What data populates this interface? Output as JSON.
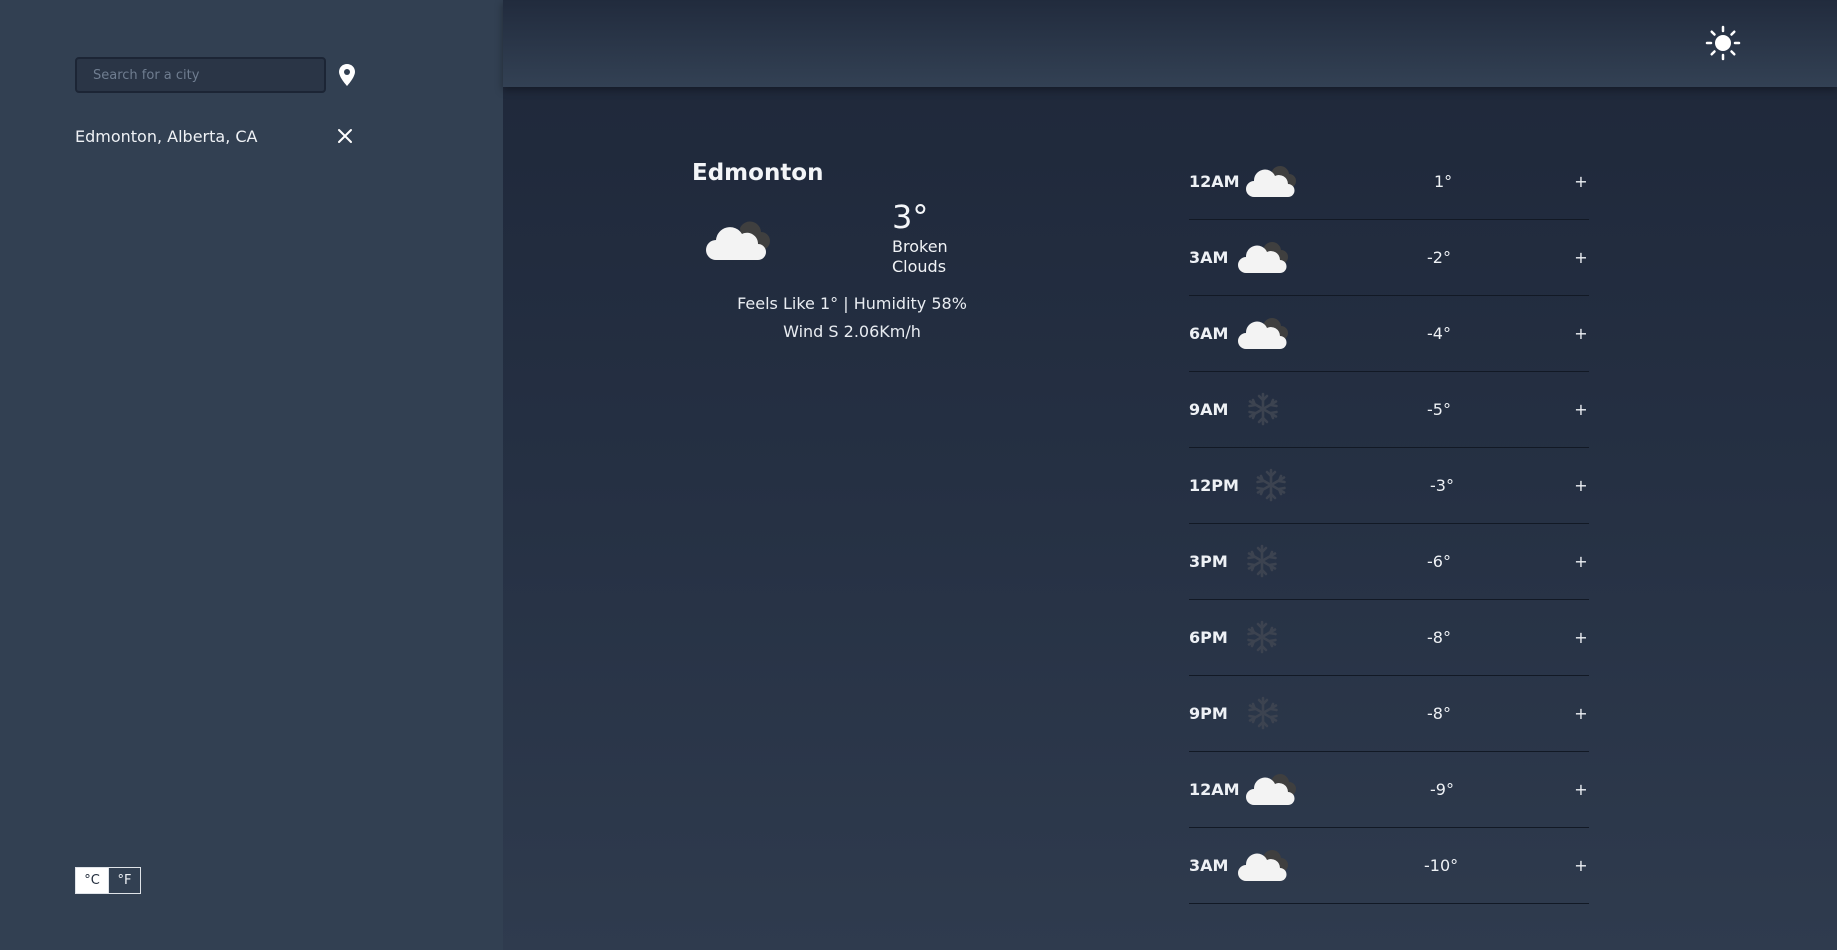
{
  "search": {
    "placeholder": "Search for a city"
  },
  "saved_cities": [
    {
      "label": "Edmonton, Alberta, CA"
    }
  ],
  "units": {
    "celsius": "°C",
    "fahrenheit": "°F",
    "active": "celsius"
  },
  "current": {
    "city": "Edmonton",
    "temp": "3°",
    "description": "Broken Clouds",
    "feels_humidity": "Feels Like 1° | Humidity 58%",
    "wind": "Wind S 2.06Km/h",
    "icon": "broken-clouds-icon"
  },
  "hourly": [
    {
      "time": "12AM",
      "temp": "1°",
      "icon": "cloud"
    },
    {
      "time": "3AM",
      "temp": "-2°",
      "icon": "cloud"
    },
    {
      "time": "6AM",
      "temp": "-4°",
      "icon": "cloud"
    },
    {
      "time": "9AM",
      "temp": "-5°",
      "icon": "snow"
    },
    {
      "time": "12PM",
      "temp": "-3°",
      "icon": "snow"
    },
    {
      "time": "3PM",
      "temp": "-6°",
      "icon": "snow"
    },
    {
      "time": "6PM",
      "temp": "-8°",
      "icon": "snow"
    },
    {
      "time": "9PM",
      "temp": "-8°",
      "icon": "snow"
    },
    {
      "time": "12AM",
      "temp": "-9°",
      "icon": "cloud"
    },
    {
      "time": "3AM",
      "temp": "-10°",
      "icon": "cloud"
    }
  ],
  "expand_label": "+",
  "theme_toggle": {
    "icon": "sun-icon"
  }
}
